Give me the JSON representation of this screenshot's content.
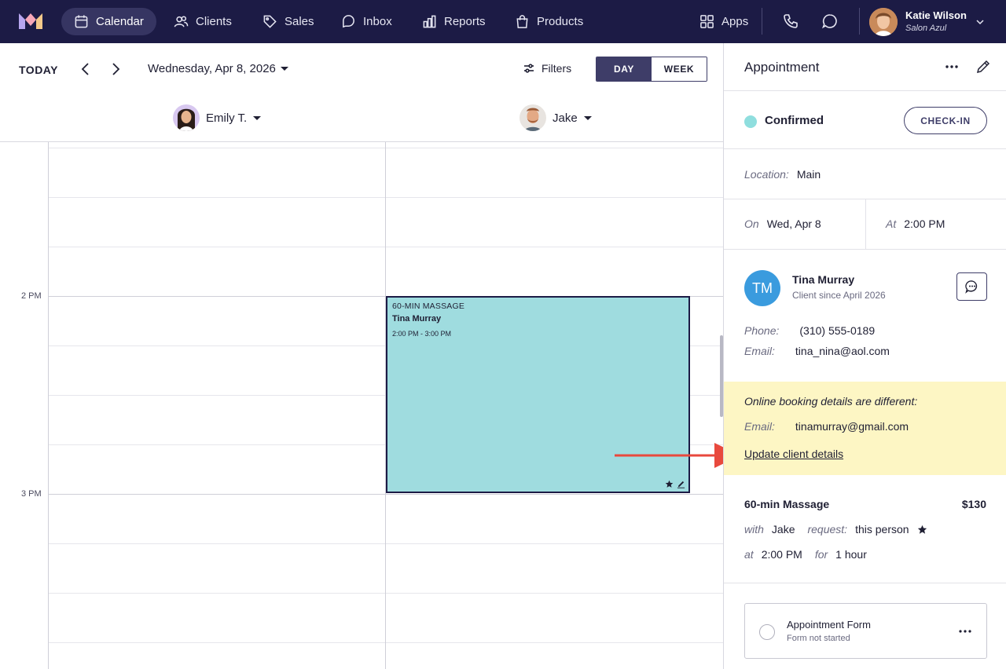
{
  "nav": {
    "items": [
      {
        "label": "Calendar",
        "icon": "calendar-icon",
        "active": true
      },
      {
        "label": "Clients",
        "icon": "users-icon"
      },
      {
        "label": "Sales",
        "icon": "tag-icon"
      },
      {
        "label": "Inbox",
        "icon": "chat-bubble-icon"
      },
      {
        "label": "Reports",
        "icon": "bar-chart-icon"
      },
      {
        "label": "Products",
        "icon": "shopping-bag-icon"
      }
    ],
    "apps_label": "Apps",
    "user": {
      "name": "Katie Wilson",
      "salon": "Salon Azul"
    }
  },
  "toolbar": {
    "today_label": "TODAY",
    "date_label": "Wednesday, Apr 8, 2026",
    "filters_label": "Filters",
    "view_day": "DAY",
    "view_week": "WEEK"
  },
  "staff": [
    {
      "name": "Emily T."
    },
    {
      "name": "Jake"
    }
  ],
  "time_labels": [
    "2 PM",
    "3 PM"
  ],
  "appointment_block": {
    "service": "60-MIN MASSAGE",
    "client": "Tina Murray",
    "time": "2:00 PM - 3:00 PM",
    "color": "#9fdcdf"
  },
  "panel": {
    "title": "Appointment",
    "status": "Confirmed",
    "status_color": "#8fdede",
    "checkin_label": "CHECK-IN",
    "location_label": "Location:",
    "location_value": "Main",
    "on_label": "On",
    "on_value": "Wed, Apr 8",
    "at_label": "At",
    "at_value": "2:00 PM",
    "client": {
      "initials": "TM",
      "name": "Tina Murray",
      "since": "Client since April 2026",
      "phone_label": "Phone:",
      "phone": "(310) 555-0189",
      "email_label": "Email:",
      "email": "tina_nina@aol.com"
    },
    "booking_notice": {
      "title": "Online booking details are different:",
      "email_label": "Email:",
      "email": "tinamurray@gmail.com",
      "update_link": "Update client details"
    },
    "service": {
      "name": "60-min Massage",
      "price": "$130",
      "with_label": "with",
      "with_value": "Jake",
      "request_label": "request:",
      "request_value": "this person",
      "at_label": "at",
      "at_value": "2:00 PM",
      "for_label": "for",
      "for_value": "1 hour"
    },
    "form": {
      "title": "Appointment Form",
      "status": "Form not started"
    }
  }
}
